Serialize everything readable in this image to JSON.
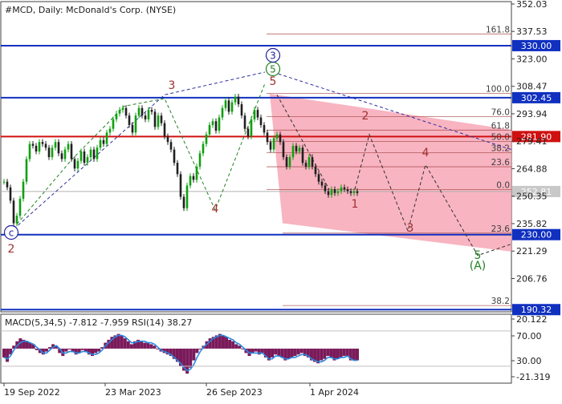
{
  "chart_data": [
    {
      "type": "line",
      "title": "#MCD, Daily:  McDonald's Corp. (NYSE)",
      "xlabel": "",
      "ylabel": "",
      "ylim": [
        192.0,
        352.0
      ],
      "x_tick_labels": [
        "19 Sep 2022",
        "23 Mar 2023",
        "26 Sep 2023",
        "1 Apr 2024"
      ],
      "y_tick_labels": [
        352.03,
        337.53,
        323.0,
        308.47,
        293.94,
        279.41,
        264.88,
        250.35,
        235.82,
        221.29,
        206.76
      ],
      "horizontal_levels": [
        {
          "value": 330.0,
          "label": "330.00",
          "color": "#1030c0"
        },
        {
          "value": 302.45,
          "label": "302.45",
          "color": "#1030c0"
        },
        {
          "value": 281.9,
          "label": "281.90",
          "color": "#d01010"
        },
        {
          "value": 230.0,
          "label": "230.00",
          "color": "#1030c0"
        },
        {
          "value": 190.32,
          "label": "190.32",
          "color": "#1030c0"
        }
      ],
      "current_price": {
        "value": 252.81,
        "label": "252.81"
      },
      "fibonacci_levels": [
        {
          "label": "161.8",
          "value": 336.2
        },
        {
          "label": "100.0",
          "value": 304.8
        },
        {
          "label": "76.0",
          "value": 292.5
        },
        {
          "label": "61.8",
          "value": 285.3
        },
        {
          "label": "50.0",
          "value": 279.3
        },
        {
          "label": "38.2",
          "value": 273.3
        },
        {
          "label": "23.6",
          "value": 265.9
        },
        {
          "label": "0.0",
          "value": 253.9
        },
        {
          "label": "23.6",
          "value": 230.8
        },
        {
          "label": "38.2",
          "value": 192.5
        }
      ],
      "wave_labels": [
        {
          "text": "(C)",
          "style": "circle",
          "color": "#2020a0"
        },
        {
          "text": "2",
          "color": "#a03030"
        },
        {
          "text": "3",
          "color": "#a03030"
        },
        {
          "text": "4",
          "color": "#a03030"
        },
        {
          "text": "5",
          "color": "#a03030"
        },
        {
          "text": "(5)",
          "style": "circle",
          "color": "#208020"
        },
        {
          "text": "3",
          "style": "circle",
          "color": "#2020a0"
        },
        {
          "text": "1",
          "color": "#a03030"
        },
        {
          "text": "2",
          "color": "#a03030"
        },
        {
          "text": "3",
          "color": "#a03030"
        },
        {
          "text": "4",
          "color": "#a03030"
        },
        {
          "text": "5",
          "color": "#208020"
        },
        {
          "text": "(A)",
          "color": "#208020"
        }
      ],
      "series": [
        {
          "name": "",
          "x": [
            0,
            4,
            8,
            12,
            16,
            20,
            24,
            28,
            32,
            36,
            40,
            44,
            48,
            52,
            56,
            60,
            64,
            68,
            72,
            76,
            80,
            84,
            88,
            92,
            96,
            100,
            104,
            108,
            112,
            116,
            120,
            124,
            128,
            132,
            136,
            140,
            144,
            148,
            152,
            156,
            160,
            164,
            168,
            172,
            176,
            180,
            184,
            188,
            192,
            196,
            200,
            204,
            208,
            212,
            216,
            220,
            224,
            228,
            232,
            236,
            240,
            244,
            248,
            252,
            256,
            260,
            264,
            268,
            272,
            276,
            280,
            284,
            288,
            292,
            296,
            300,
            304,
            308,
            312,
            316,
            320,
            324,
            328,
            332,
            336,
            340,
            344,
            348,
            352,
            356,
            360,
            364,
            368,
            372,
            376,
            380,
            384,
            388,
            392,
            396,
            400,
            404,
            408,
            412,
            416,
            420,
            424,
            428,
            432,
            436,
            440
          ],
          "values": [
            258,
            255,
            248,
            236,
            240,
            249,
            258,
            270,
            278,
            277,
            274,
            279,
            278,
            276,
            271,
            276,
            279,
            273,
            270,
            275,
            278,
            270,
            265,
            269,
            274,
            268,
            271,
            275,
            270,
            276,
            280,
            278,
            284,
            286,
            291,
            294,
            296,
            297,
            293,
            288,
            284,
            293,
            297,
            293,
            291,
            296,
            295,
            287,
            293,
            289,
            282,
            279,
            275,
            268,
            262,
            250,
            244,
            256,
            261,
            259,
            266,
            273,
            278,
            283,
            288,
            290,
            285,
            292,
            297,
            301,
            295,
            300,
            303,
            299,
            293,
            286,
            282,
            291,
            296,
            292,
            288,
            284,
            279,
            275,
            281,
            283,
            279,
            271,
            266,
            271,
            277,
            274,
            276,
            268,
            266,
            271,
            266,
            262,
            258,
            256,
            253,
            251,
            254,
            252,
            253,
            255,
            254,
            253,
            252,
            253,
            252
          ]
        }
      ]
    },
    {
      "type": "bar",
      "title": "MACD(5,34,5) -7.812 -7.959 RSI(14) 38.27",
      "xlabel": "",
      "ylabel": "",
      "y_tick_labels": [
        20.122,
        70.0,
        30.0,
        -21.319
      ],
      "series": [
        {
          "name": "",
          "values": [
            -6,
            -9,
            -4,
            2,
            5,
            7,
            6,
            5,
            4,
            3,
            -1,
            -3,
            -4,
            -2,
            1,
            3,
            2,
            -3,
            -5,
            -2,
            0,
            -2,
            -4,
            -3,
            -1,
            -2,
            -4,
            -5,
            -3,
            -2,
            1,
            4,
            6,
            8,
            9,
            10,
            9,
            7,
            5,
            3,
            5,
            6,
            5,
            4,
            4,
            3,
            2,
            0,
            -2,
            -3,
            -4,
            -5,
            -7,
            -9,
            -12,
            -15,
            -17,
            -13,
            -8,
            -3,
            0,
            2,
            5,
            7,
            8,
            9,
            10,
            9,
            8,
            6,
            5,
            3,
            2,
            0,
            -3,
            -5,
            -3,
            -2,
            -4,
            -3,
            -6,
            -8,
            -6,
            -4,
            -5,
            -6,
            -8,
            -7,
            -6,
            -5,
            -4,
            -3,
            -5,
            -6,
            -8,
            -9,
            -10,
            -8,
            -7,
            -5,
            -6,
            -8,
            -7,
            -6,
            -5,
            -5,
            -8,
            -8,
            -8
          ]
        },
        {
          "name": "",
          "values": [
            -6,
            -7,
            -5,
            -1,
            2,
            4,
            5,
            5,
            4,
            3,
            1,
            -1,
            -3,
            -3,
            -1,
            1,
            2,
            0,
            -3,
            -3,
            -2,
            -2,
            -3,
            -3,
            -2,
            -2,
            -3,
            -4,
            -4,
            -3,
            -1,
            2,
            4,
            6,
            8,
            9,
            9,
            8,
            6,
            4,
            4,
            5,
            5,
            5,
            4,
            4,
            3,
            1,
            -1,
            -2,
            -3,
            -4,
            -6,
            -8,
            -10,
            -13,
            -15,
            -14,
            -11,
            -6,
            -2,
            1,
            3,
            5,
            7,
            8,
            9,
            9,
            8,
            7,
            6,
            4,
            3,
            1,
            -1,
            -3,
            -3,
            -3,
            -3,
            -3,
            -5,
            -7,
            -7,
            -5,
            -5,
            -6,
            -7,
            -7,
            -6,
            -6,
            -5,
            -4,
            -4,
            -5,
            -7,
            -8,
            -9,
            -9,
            -8,
            -6,
            -6,
            -7,
            -7,
            -6,
            -6,
            -5,
            -7,
            -8,
            -8
          ]
        }
      ]
    }
  ],
  "colors": {
    "candle_up": "#10a010",
    "candle_down": "#202020",
    "macd_hist": "#7a1a5a",
    "macd_signal": "#2a8ae0",
    "forecast_zone": "#f7a7b6",
    "blue_level": "#1030c0",
    "red_level": "#d01010",
    "fib_line": "#a04040",
    "price_tag": "#c8c8c8",
    "axis_text": "#202020"
  }
}
